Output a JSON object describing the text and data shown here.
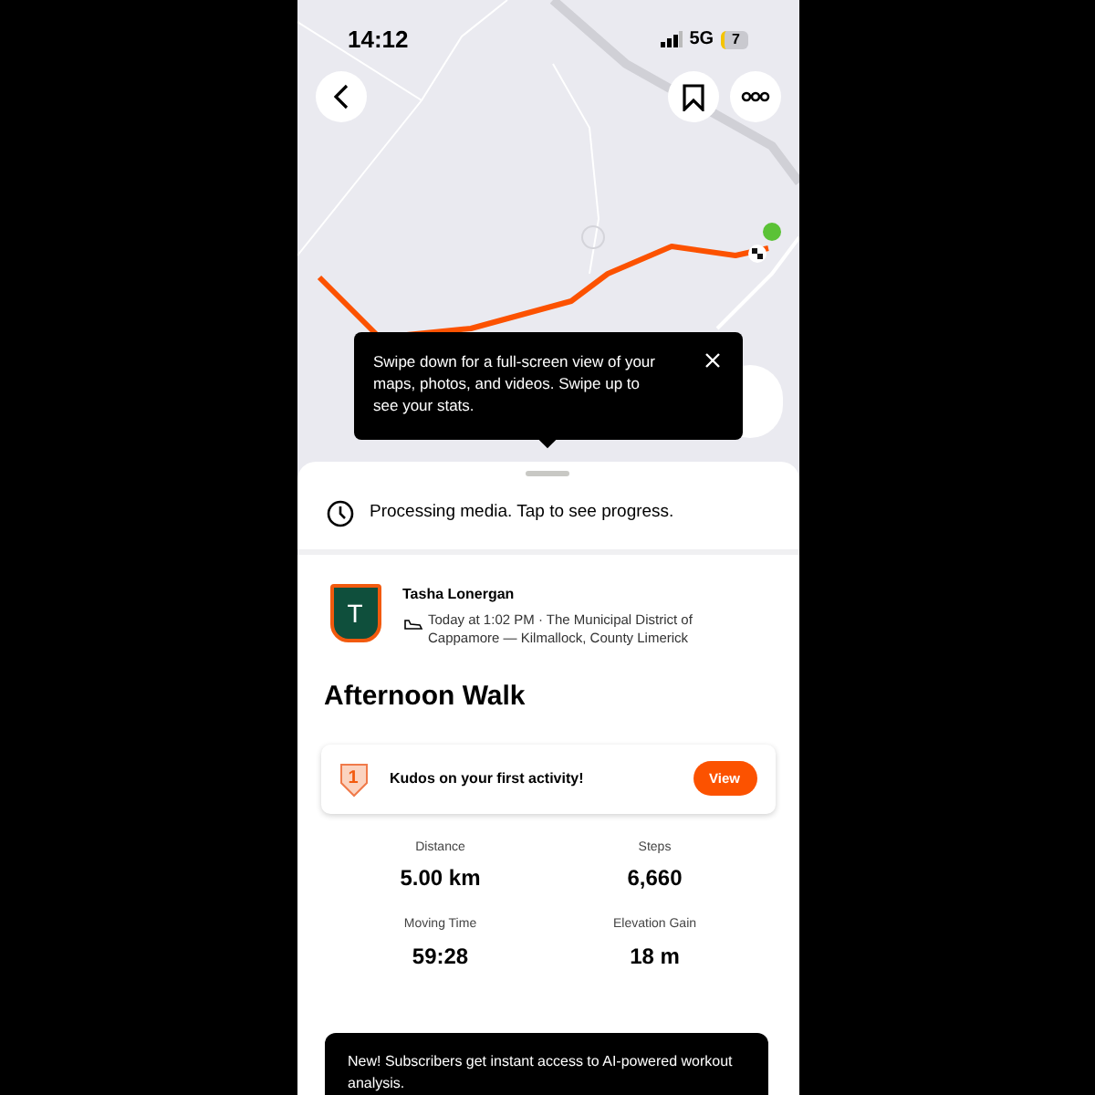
{
  "status_bar": {
    "time": "14:12",
    "network": "5G",
    "battery": "7"
  },
  "tooltip": {
    "text": "Swipe down for a full-screen view of your maps, photos, and videos. Swipe up to see your stats."
  },
  "processing": {
    "text": "Processing media. Tap to see progress."
  },
  "athlete": {
    "initial": "T",
    "name": "Tasha Lonergan",
    "meta": "Today at 1:02 PM · The Municipal District of Cappamore — Kilmallock, County Limerick"
  },
  "activity_title": "Afternoon Walk",
  "kudos": {
    "badge": "1",
    "text": "Kudos on your first activity!",
    "button": "View"
  },
  "stats": [
    {
      "label": "Distance",
      "value": "5.00 km"
    },
    {
      "label": "Steps",
      "value": "6,660"
    },
    {
      "label": "Moving Time",
      "value": "59:28"
    },
    {
      "label": "Elevation Gain",
      "value": "18 m"
    }
  ],
  "banner": {
    "text": "New! Subscribers get instant access to AI-powered workout analysis."
  }
}
